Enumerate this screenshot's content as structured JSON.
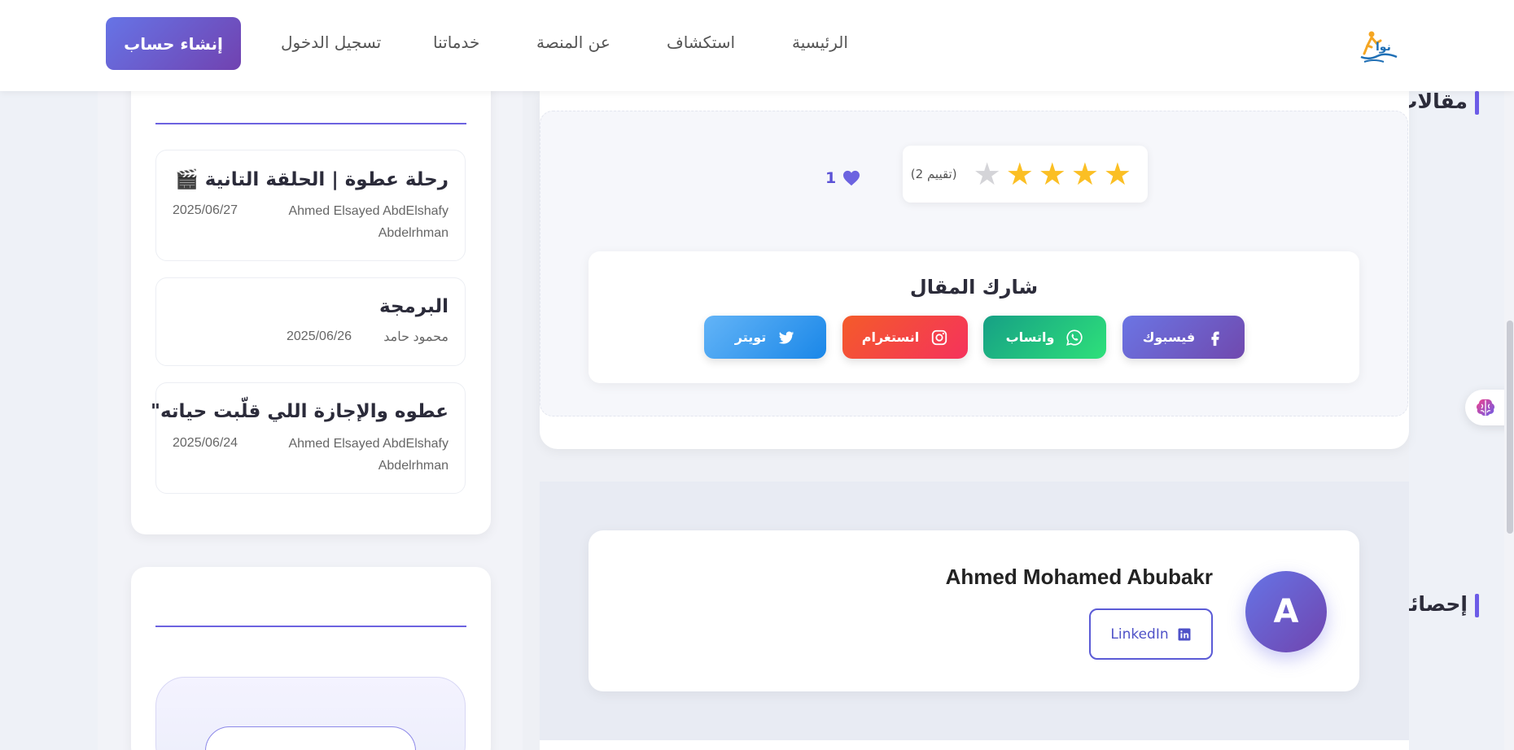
{
  "nav": {
    "signup": "إنشاء حساب",
    "login": "تسجيل الدخول",
    "services": "خدماتنا",
    "about": "عن المنصة",
    "explore": "استكشاف",
    "home": "الرئيسية"
  },
  "rating": {
    "stars_filled": 4,
    "stars_total": 5,
    "count_label": "(2 تقييم)",
    "star_color": "#fbbf24"
  },
  "likes": {
    "count": "1"
  },
  "share": {
    "title": "شارك المقال",
    "facebook": "فيسبوك",
    "whatsapp": "واتساب",
    "instagram": "انستغرام",
    "twitter": "تويتر"
  },
  "author": {
    "initial": "A",
    "name": "Ahmed Mohamed Abubakr",
    "linkedin": "LinkedIn"
  },
  "related": {
    "title": "مقالات مشابهة",
    "items": [
      {
        "title": "🎬 رحلة عطوة | الحلقة التانية",
        "author": "Ahmed Elsayed AbdElshafy Abdelrhman",
        "date": "2025/06/27"
      },
      {
        "title": "البرمجة",
        "author": "محمود حامد",
        "date": "2025/06/26"
      },
      {
        "title": "\"عطوه والإجازة اللي قلّبت حياته",
        "author": "Ahmed Elsayed AbdElshafy Abdelrhman",
        "date": "2025/06/24"
      }
    ]
  },
  "stats": {
    "title": "إحصائيات المقال"
  },
  "colors": {
    "accent": "#6c5ce7",
    "brand_gradient_start": "#6674e6",
    "brand_gradient_end": "#7044ae"
  }
}
